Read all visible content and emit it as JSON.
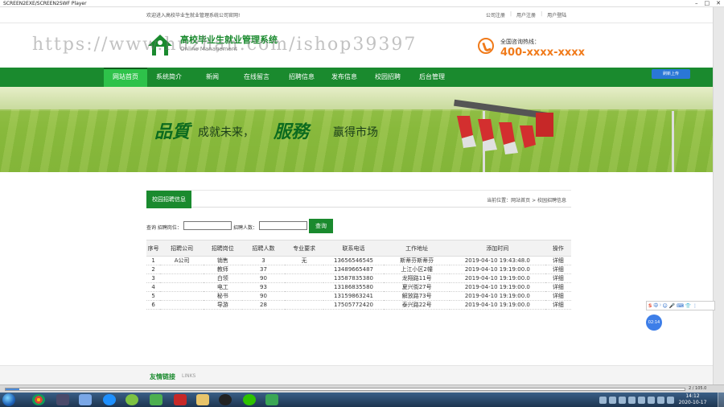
{
  "window": {
    "title": "SCREEN2EXE/SCREEN2SWF Player",
    "minimize": "–",
    "maximize": "□",
    "close": "✕"
  },
  "topbar": {
    "welcome": "欢迎进入高校毕业生就业管理系统公司官网!",
    "links": [
      "公司注册",
      "用户注册",
      "用户登陆"
    ]
  },
  "header": {
    "site_title": "高校毕业生就业管理系统",
    "site_sub": "Online Management",
    "watermark": "https://www.huzhan.com/ishop39397",
    "hotline_label": "全国咨询热线：",
    "hotline_number": "400-xxxx-xxxx"
  },
  "nav": {
    "items": [
      "网站首页",
      "系统简介",
      "新闻",
      "在线留言",
      "招聘信息",
      "发布信息",
      "校园招聘",
      "后台管理"
    ],
    "active_index": 0,
    "share_button": "刷新上传"
  },
  "banner": {
    "slogan_a": "品質",
    "slogan_b": "成就未来，",
    "slogan_c": "服務",
    "slogan_d": "赢得市场"
  },
  "section": {
    "tab": "校园招聘信息",
    "breadcrumb": "当前位置：网站首页 > 校园招聘信息"
  },
  "search": {
    "label_position": "查询 招聘岗位：",
    "position_value": "",
    "label_count": "招聘人数：",
    "count_value": "",
    "button": "查询"
  },
  "table": {
    "headers": [
      "序号",
      "招聘公司",
      "招聘岗位",
      "招聘人数",
      "专业要求",
      "联系电话",
      "工作地址",
      "添加时间",
      "操作"
    ],
    "rows": [
      [
        "1",
        "A公司",
        "销售",
        "3",
        "无",
        "13656546545",
        "斯蒂芬斯蒂芬",
        "2019-04-10 19:43:48.0",
        "详细"
      ],
      [
        "2",
        "",
        "教师",
        "37",
        "",
        "13489665487",
        "上江小区2幢",
        "2019-04-10 19:19:00.0",
        "详细"
      ],
      [
        "3",
        "",
        "白领",
        "90",
        "",
        "13587835380",
        "龙翔路11号",
        "2019-04-10 19:19:00.0",
        "详细"
      ],
      [
        "4",
        "",
        "电工",
        "93",
        "",
        "13186835580",
        "夏兴街27号",
        "2019-04-10 19:19:00.0",
        "详细"
      ],
      [
        "5",
        "",
        "秘书",
        "90",
        "",
        "13159863241",
        "解放路73号",
        "2019-04-10 19:19:00.0",
        "详细"
      ],
      [
        "6",
        "",
        "导游",
        "28",
        "",
        "17505772420",
        "泰兴路22号",
        "2019-04-10 19:19:00.0",
        "详细"
      ]
    ]
  },
  "friend_links": {
    "title": "友情链接",
    "sub": "LINKS"
  },
  "overlay": {
    "ime": "中 ⁾ ☺ 🎤 ⌨ 👕 ⋮",
    "ime_logo": "S",
    "timer": "02:14"
  },
  "player": {
    "time": "2 / 105.0",
    "progress": 0.02
  },
  "taskbar": {
    "time": "14:12",
    "date": "2020-10-17"
  },
  "colors": {
    "brand_green": "#1a8a2e",
    "nav_active": "#2ec24a",
    "hotline_orange": "#f07a1a"
  }
}
